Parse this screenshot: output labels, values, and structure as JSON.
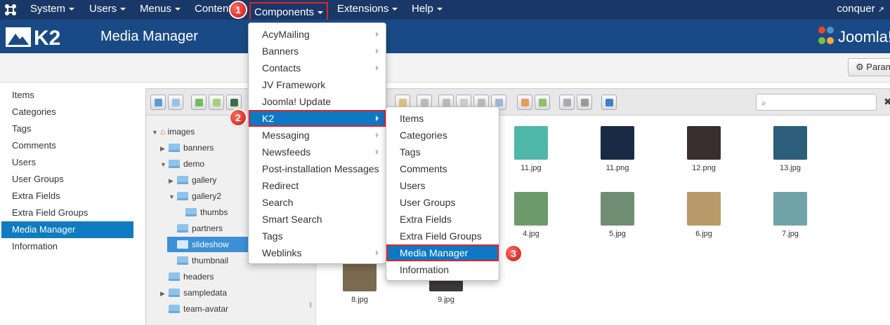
{
  "topnav": {
    "items": [
      "System",
      "Users",
      "Menus",
      "Content",
      "Components",
      "Extensions",
      "Help"
    ],
    "user": "conquer"
  },
  "header": {
    "logo_text": "K2",
    "title": "Media Manager",
    "brand": "Joomla!"
  },
  "toolbar": {
    "params_label": "Param"
  },
  "sidebar": {
    "items": [
      "Items",
      "Categories",
      "Tags",
      "Comments",
      "Users",
      "User Groups",
      "Extra Fields",
      "Extra Field Groups",
      "Media Manager",
      "Information"
    ],
    "active": "Media Manager"
  },
  "components_menu": {
    "items": [
      "AcyMailing",
      "Banners",
      "Contacts",
      "JV Framework",
      "Joomla! Update",
      "K2",
      "Messaging",
      "Newsfeeds",
      "Post-installation Messages",
      "Redirect",
      "Search",
      "Smart Search",
      "Tags",
      "Weblinks"
    ],
    "active": "K2"
  },
  "k2_submenu": {
    "items": [
      "Items",
      "Categories",
      "Tags",
      "Comments",
      "Users",
      "User Groups",
      "Extra Fields",
      "Extra Field Groups",
      "Media Manager",
      "Information"
    ],
    "active": "Media Manager"
  },
  "steps": [
    "1",
    "2",
    "3"
  ],
  "tree": {
    "root": "images",
    "nodes": [
      "banners",
      "demo",
      "gallery",
      "gallery2",
      "thumbs",
      "partners",
      "slideshow",
      "thumbnail",
      "headers",
      "sampledata",
      "team-avatar"
    ],
    "selected": "slideshow"
  },
  "files": [
    {
      "name": "11.jpg",
      "color": "#4fb7a8"
    },
    {
      "name": "11.png",
      "color": "#1b2a44"
    },
    {
      "name": "12.png",
      "color": "#3a2e2e"
    },
    {
      "name": "13.jpg",
      "color": "#2c5d7a"
    },
    {
      "name": "4.jpg",
      "color": "#6b9b6a"
    },
    {
      "name": "5.jpg",
      "color": "#6f8d73"
    },
    {
      "name": "6.jpg",
      "color": "#b89a6a"
    },
    {
      "name": "7.jpg",
      "color": "#6fa3a8"
    },
    {
      "name": "8.jpg",
      "color": "#7a6a4f"
    },
    {
      "name": "9.jpg",
      "color": "#3b3a38"
    }
  ],
  "colors": {
    "topbar": "#1a3867",
    "header": "#1a4a85",
    "accent": "#0f7bc1",
    "highlight_border": "#e2232a"
  }
}
